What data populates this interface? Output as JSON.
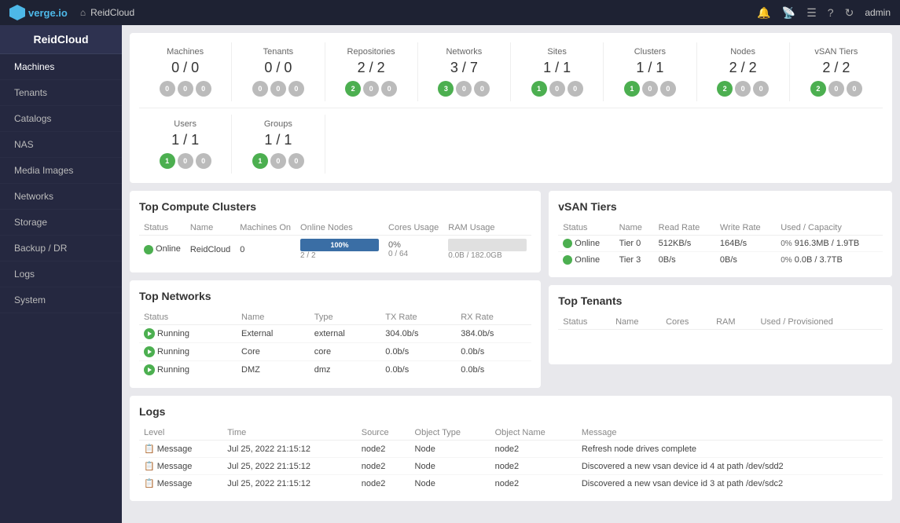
{
  "topNav": {
    "brandName": "verge.io",
    "cloudName": "ReidCloud",
    "adminLabel": "admin"
  },
  "sidebar": {
    "cloudHeader": "ReidCloud",
    "items": [
      {
        "label": "Machines",
        "active": true
      },
      {
        "label": "Tenants"
      },
      {
        "label": "Catalogs"
      },
      {
        "label": "NAS"
      },
      {
        "label": "Media Images"
      },
      {
        "label": "Networks"
      },
      {
        "label": "Storage"
      },
      {
        "label": "Backup / DR"
      },
      {
        "label": "Logs"
      },
      {
        "label": "System"
      }
    ]
  },
  "statsRow1": [
    {
      "title": "Machines",
      "value": "0 / 0",
      "badges": [
        {
          "val": "0",
          "type": "gray"
        },
        {
          "val": "0",
          "type": "gray"
        },
        {
          "val": "0",
          "type": "gray"
        }
      ]
    },
    {
      "title": "Tenants",
      "value": "0 / 0",
      "badges": [
        {
          "val": "0",
          "type": "gray"
        },
        {
          "val": "0",
          "type": "gray"
        },
        {
          "val": "0",
          "type": "gray"
        }
      ]
    },
    {
      "title": "Repositories",
      "value": "2 / 2",
      "badges": [
        {
          "val": "2",
          "type": "green"
        },
        {
          "val": "0",
          "type": "gray"
        },
        {
          "val": "0",
          "type": "gray"
        }
      ]
    },
    {
      "title": "Networks",
      "value": "3 / 7",
      "badges": [
        {
          "val": "3",
          "type": "green"
        },
        {
          "val": "0",
          "type": "gray"
        },
        {
          "val": "0",
          "type": "gray"
        }
      ]
    },
    {
      "title": "Sites",
      "value": "1 / 1",
      "badges": [
        {
          "val": "1",
          "type": "green"
        },
        {
          "val": "0",
          "type": "gray"
        },
        {
          "val": "0",
          "type": "gray"
        }
      ]
    },
    {
      "title": "Clusters",
      "value": "1 / 1",
      "badges": [
        {
          "val": "1",
          "type": "green"
        },
        {
          "val": "0",
          "type": "gray"
        },
        {
          "val": "0",
          "type": "gray"
        }
      ]
    },
    {
      "title": "Nodes",
      "value": "2 / 2",
      "badges": [
        {
          "val": "2",
          "type": "green"
        },
        {
          "val": "0",
          "type": "gray"
        },
        {
          "val": "0",
          "type": "gray"
        }
      ]
    },
    {
      "title": "vSAN Tiers",
      "value": "2 / 2",
      "badges": [
        {
          "val": "2",
          "type": "green"
        },
        {
          "val": "0",
          "type": "gray"
        },
        {
          "val": "0",
          "type": "gray"
        }
      ]
    }
  ],
  "statsRow2": [
    {
      "title": "Users",
      "value": "1 / 1",
      "badges": [
        {
          "val": "1",
          "type": "green"
        },
        {
          "val": "0",
          "type": "gray"
        },
        {
          "val": "0",
          "type": "gray"
        }
      ]
    },
    {
      "title": "Groups",
      "value": "1 / 1",
      "badges": [
        {
          "val": "1",
          "type": "green"
        },
        {
          "val": "0",
          "type": "gray"
        },
        {
          "val": "0",
          "type": "gray"
        }
      ]
    }
  ],
  "computeClusters": {
    "title": "Top Compute Clusters",
    "headers": [
      "Status",
      "Name",
      "Machines On",
      "Online Nodes",
      "Cores Usage",
      "RAM Usage"
    ],
    "rows": [
      {
        "status": "Online",
        "name": "ReidCloud",
        "machines": "0",
        "onlineNodes": "2 / 2",
        "coresPercent": 100,
        "coresLabel": "100%",
        "coresDetail": "0 / 64",
        "coresDetailLabel": "0%",
        "ramPercent": 0,
        "ramLabel": "0%",
        "ramDetail": "0.0B / 182.0GB"
      }
    ]
  },
  "networks": {
    "title": "Top Networks",
    "headers": [
      "Status",
      "Name",
      "Type",
      "TX Rate",
      "RX Rate"
    ],
    "rows": [
      {
        "status": "Running",
        "name": "External",
        "type": "external",
        "tx": "304.0b/s",
        "rx": "384.0b/s"
      },
      {
        "status": "Running",
        "name": "Core",
        "type": "core",
        "tx": "0.0b/s",
        "rx": "0.0b/s"
      },
      {
        "status": "Running",
        "name": "DMZ",
        "type": "dmz",
        "tx": "0.0b/s",
        "rx": "0.0b/s"
      }
    ]
  },
  "vsanTiers": {
    "title": "vSAN Tiers",
    "headers": [
      "Status",
      "Name",
      "Read Rate",
      "Write Rate",
      "Used / Capacity"
    ],
    "rows": [
      {
        "status": "Online",
        "name": "Tier 0",
        "readRate": "512KB/s",
        "writeRate": "164B/s",
        "usedPercent": 2,
        "usedLabel": "0%",
        "capacity": "916.3MB / 1.9TB"
      },
      {
        "status": "Online",
        "name": "Tier 3",
        "readRate": "0B/s",
        "writeRate": "0B/s",
        "usedPercent": 0,
        "usedLabel": "0%",
        "capacity": "0.0B / 3.7TB"
      }
    ]
  },
  "topTenants": {
    "title": "Top Tenants",
    "headers": [
      "Status",
      "Name",
      "Cores",
      "RAM",
      "Used / Provisioned"
    ],
    "rows": []
  },
  "logs": {
    "title": "Logs",
    "headers": [
      "Level",
      "Time",
      "Source",
      "Object Type",
      "Object Name",
      "Message"
    ],
    "rows": [
      {
        "level": "Message",
        "time": "Jul 25, 2022 21:15:12",
        "source": "node2",
        "objectType": "Node",
        "objectName": "node2",
        "message": "Refresh node drives complete"
      },
      {
        "level": "Message",
        "time": "Jul 25, 2022 21:15:12",
        "source": "node2",
        "objectType": "Node",
        "objectName": "node2",
        "message": "Discovered a new vsan device id 4 at path /dev/sdd2"
      },
      {
        "level": "Message",
        "time": "Jul 25, 2022 21:15:12",
        "source": "node2",
        "objectType": "Node",
        "objectName": "node2",
        "message": "Discovered a new vsan device id 3 at path /dev/sdc2"
      }
    ]
  }
}
